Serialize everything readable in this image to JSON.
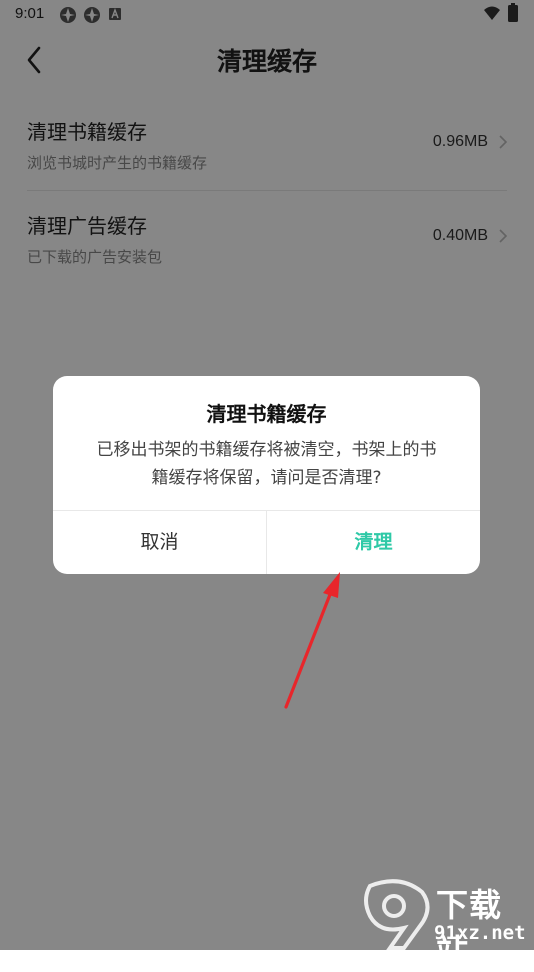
{
  "status_bar": {
    "time": "9:01"
  },
  "header": {
    "title": "清理缓存"
  },
  "cache_items": [
    {
      "title": "清理书籍缓存",
      "description": "浏览书城时产生的书籍缓存",
      "size": "0.96MB"
    },
    {
      "title": "清理广告缓存",
      "description": "已下载的广告安装包",
      "size": "0.40MB"
    }
  ],
  "dialog": {
    "title": "清理书籍缓存",
    "message_line1": "已移出书架的书籍缓存将被清空，书架上的书",
    "message_line2": "籍缓存将保留，请问是否清理?",
    "cancel_label": "取消",
    "confirm_label": "清理"
  },
  "watermark": {
    "brand_cn": "下载站",
    "brand_url": "91xz.net"
  },
  "colors": {
    "accent": "#2ec9a7",
    "annotation_arrow": "#e8262b",
    "overlay": "rgba(0,0,0,0.47)"
  }
}
